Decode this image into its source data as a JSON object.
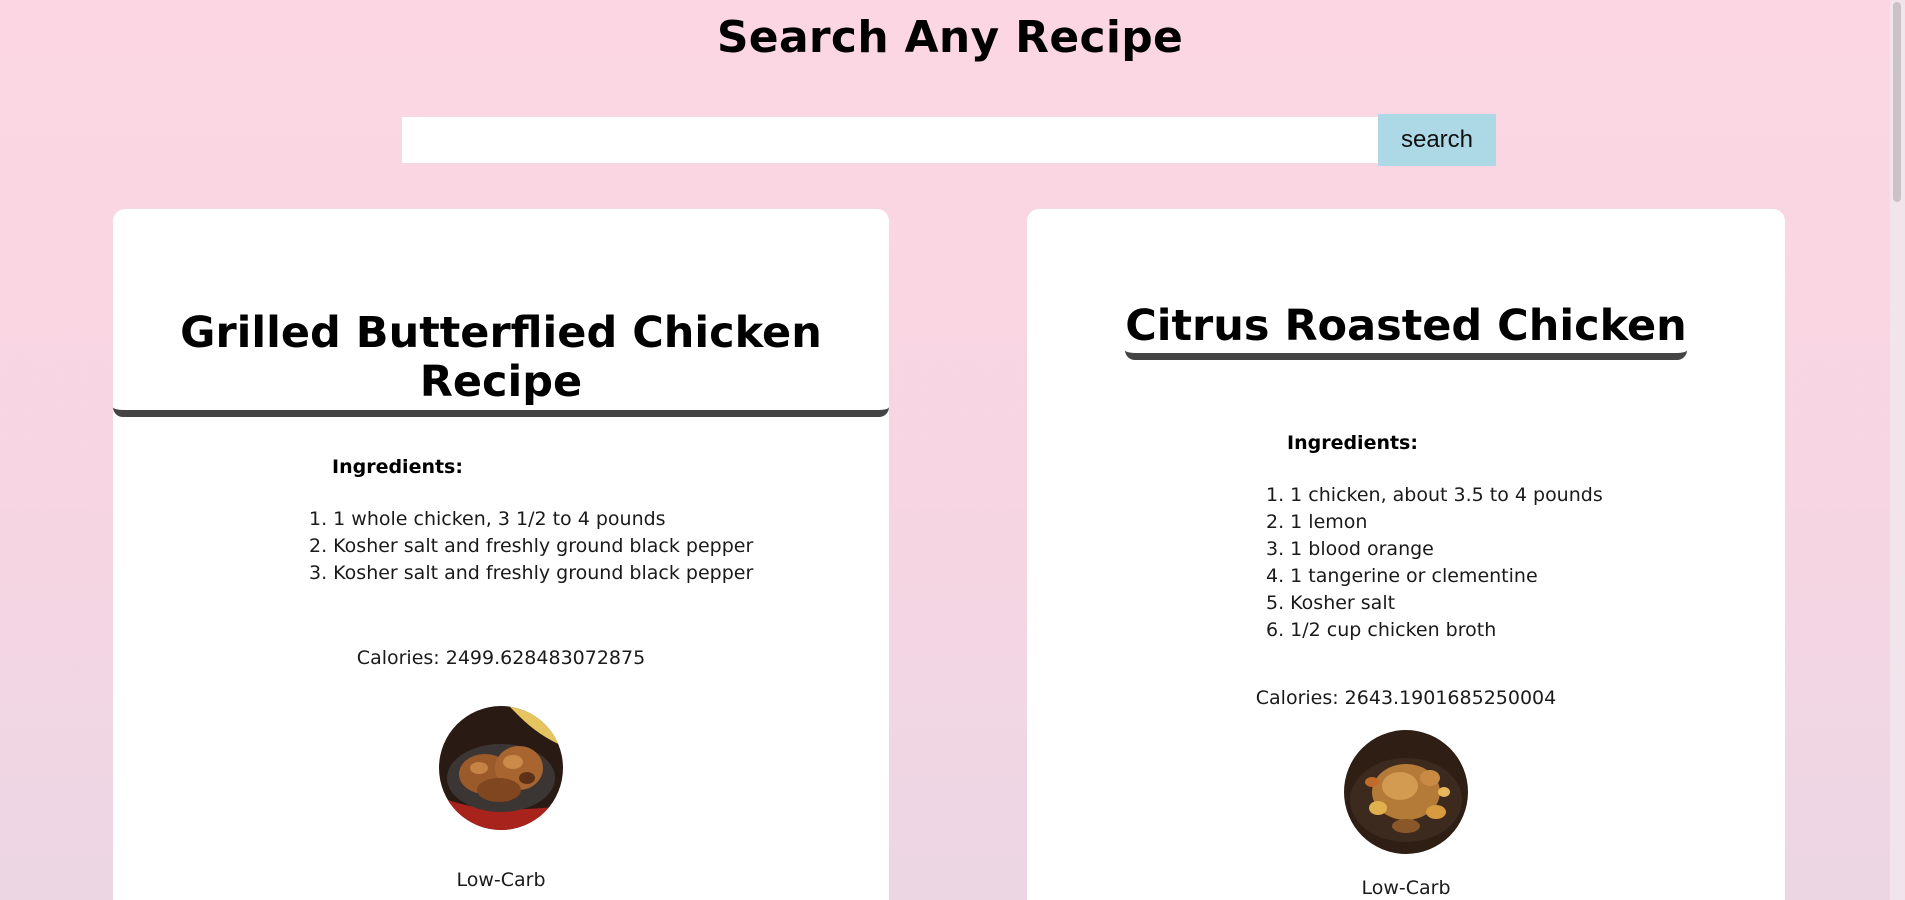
{
  "page": {
    "title": "Search Any Recipe"
  },
  "search": {
    "value": "",
    "placeholder": "",
    "button_label": "search"
  },
  "recipes": [
    {
      "title": "Grilled Butterflied Chicken Recipe",
      "ingredients_label": "Ingredients:",
      "ingredients": [
        "1. 1 whole chicken, 3 1/2 to 4 pounds",
        "2. Kosher salt and freshly ground black pepper",
        "3. Kosher salt and freshly ground black pepper"
      ],
      "calories": "Calories: 2499.628483072875",
      "diet_label": "Low-Carb"
    },
    {
      "title": "Citrus Roasted Chicken",
      "ingredients_label": "Ingredients:",
      "ingredients": [
        "1. 1 chicken, about 3.5 to 4 pounds",
        "2. 1 lemon",
        "3. 1 blood orange",
        "4. 1 tangerine or clementine",
        "5. Kosher salt",
        "6. 1/2 cup chicken broth"
      ],
      "calories": "Calories: 2643.1901685250004",
      "diet_label": "Low-Carb"
    }
  ],
  "colors": {
    "search_button": "#add8e6",
    "background": "#fcd6e3",
    "card": "#ffffff"
  }
}
